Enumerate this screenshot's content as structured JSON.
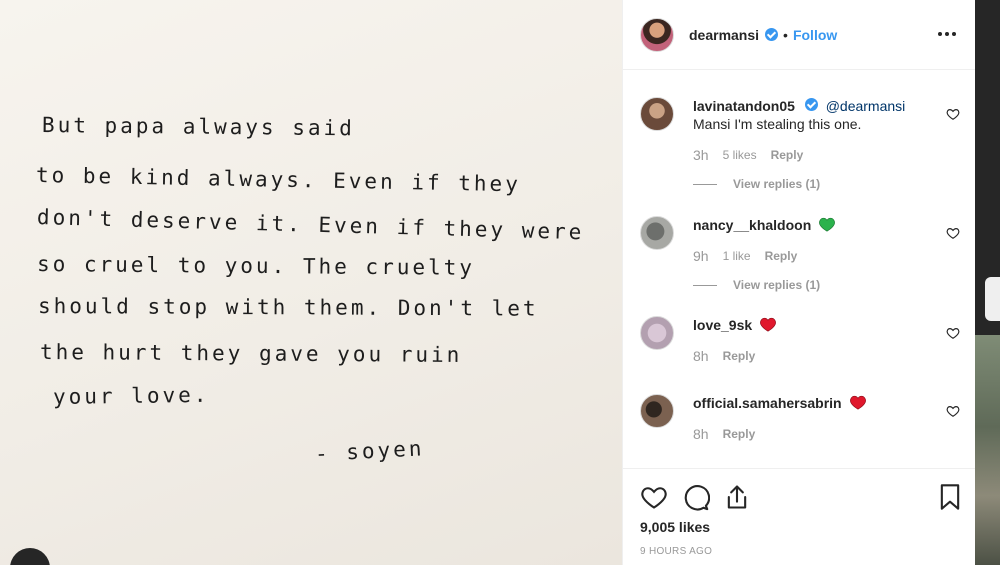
{
  "post": {
    "note_lines": [
      "But papa always said",
      "to be kind always. Even if they",
      "don't deserve it. Even if they were",
      "so cruel to you. The cruelty",
      "should stop with them. Don't let",
      "the hurt they gave you ruin",
      "your love.",
      "- soyen"
    ]
  },
  "header": {
    "username": "dearmansi",
    "verified": true,
    "separator": "•",
    "follow_label": "Follow",
    "more_icon": "more-options-icon"
  },
  "comments": [
    {
      "username": "lavinatandon05",
      "verified": true,
      "mention": "@dearmansi",
      "text": "Mansi I'm stealing this one.",
      "time": "3h",
      "likes": "5 likes",
      "reply_label": "Reply",
      "view_replies": "View replies (1)",
      "avatar_color": "#7a5a46"
    },
    {
      "username": "nancy__khaldoon",
      "emoji": "green-heart",
      "emoji_color": "#2bb24c",
      "time": "9h",
      "likes": "1 like",
      "reply_label": "Reply",
      "view_replies": "View replies (1)",
      "avatar_color": "#8d8f8c"
    },
    {
      "username": "love_9sk",
      "emoji": "red-heart",
      "emoji_color": "#e0182d",
      "time": "8h",
      "reply_label": "Reply",
      "avatar_color": "#c9b7c8"
    },
    {
      "username": "official.samahersabrin",
      "emoji": "red-heart",
      "emoji_color": "#e0182d",
      "time": "8h",
      "reply_label": "Reply",
      "avatar_color": "#5b4638"
    }
  ],
  "actions": {
    "like_icon": "heart-outline-icon",
    "comment_icon": "comment-bubble-icon",
    "share_icon": "share-upload-icon",
    "save_icon": "bookmark-icon",
    "likes_count": "9,005 likes",
    "time_ago": "9 HOURS AGO"
  },
  "colors": {
    "accent": "#3897f0",
    "text": "#262626",
    "muted": "#999999",
    "border": "#efefef"
  }
}
